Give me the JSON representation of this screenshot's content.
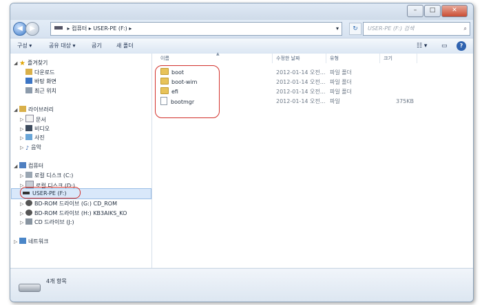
{
  "address": {
    "crumb_computer": "컴퓨터",
    "crumb_drive": "USER-PE (F:)",
    "search_placeholder": "USER-PE (F:) 검색"
  },
  "toolbar": {
    "organize": "구성 ▾",
    "share": "공유 대상 ▾",
    "burn": "굽기",
    "new_folder": "새 폴더"
  },
  "nav": {
    "favorites": "즐겨찾기",
    "downloads": "다운로드",
    "desktop": "바탕 화면",
    "recent": "최근 위치",
    "libraries": "라이브러리",
    "documents": "문서",
    "videos": "비디오",
    "pictures": "사진",
    "music": "음악",
    "computer": "컴퓨터",
    "local_c": "로컬 디스크 (C:)",
    "local_d": "로컬 디스크 (D:)",
    "userpe": "USER-PE (F:)",
    "bd_g": "BD-ROM 드라이브 (G:) CD_ROM",
    "bd_h": "BD-ROM 드라이브 (H:) KB3AIKS_KO",
    "cd_j": "CD 드라이브 (J:)",
    "network": "네트워크"
  },
  "columns": {
    "name": "이름",
    "date": "수정한 날짜",
    "type": "유형",
    "size": "크기"
  },
  "files": [
    {
      "name": "boot",
      "date": "2012-01-14 오전...",
      "type": "파일 폴더",
      "size": ""
    },
    {
      "name": "boot-wim",
      "date": "2012-01-14 오전...",
      "type": "파일 폴더",
      "size": ""
    },
    {
      "name": "efi",
      "date": "2012-01-14 오전...",
      "type": "파일 폴더",
      "size": ""
    },
    {
      "name": "bootmgr",
      "date": "2012-01-14 오전...",
      "type": "파일",
      "size": "375KB"
    }
  ],
  "status": {
    "item_count": "4개 항목"
  },
  "colors": {
    "highlight": "#d2302a",
    "selection": "#d9e8fa"
  }
}
